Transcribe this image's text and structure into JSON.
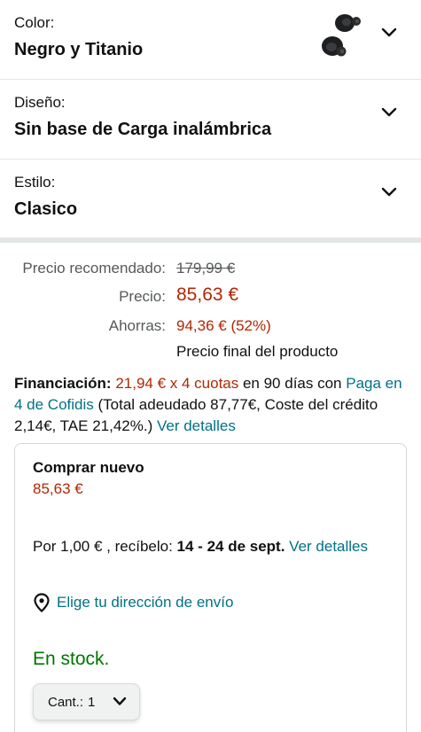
{
  "variants": [
    {
      "label": "Color:",
      "value": "Negro y Titanio",
      "thumbnail": "black-earbuds-image"
    },
    {
      "label": "Diseño:",
      "value": "Sin base de Carga inalámbrica"
    },
    {
      "label": "Estilo:",
      "value": "Clasico"
    }
  ],
  "pricing": {
    "list_label": "Precio recomendado:",
    "list_price": "179,99 €",
    "price_label": "Precio:",
    "price": "85,63 €",
    "savings_label": "Ahorras:",
    "savings": "94,36 € (52%)",
    "final_note": "Precio final del producto"
  },
  "financing": {
    "title": "Financiación:",
    "installments": "21,94 € x 4 cuotas",
    "period": " en 90 días con",
    "provider_link": "Paga en 4 de Cofidis",
    "details_text": " (Total adeudado 87,77€, Coste del crédito 2,14€, TAE 21,42%.)",
    "details_link": "Ver detalles"
  },
  "buy_box": {
    "title": "Comprar nuevo",
    "price": "85,63 €",
    "delivery_prefix": "Por 1,00 € , recíbelo: ",
    "delivery_dates": "14 - 24 de sept.",
    "delivery_link": "Ver detalles",
    "address_link": "Elige tu dirección de envío",
    "stock": "En stock.",
    "qty_label": "Cant.:",
    "qty_value": "1"
  },
  "colors": {
    "price_red": "#b12704",
    "link_teal": "#007185",
    "stock_green": "#007600"
  }
}
